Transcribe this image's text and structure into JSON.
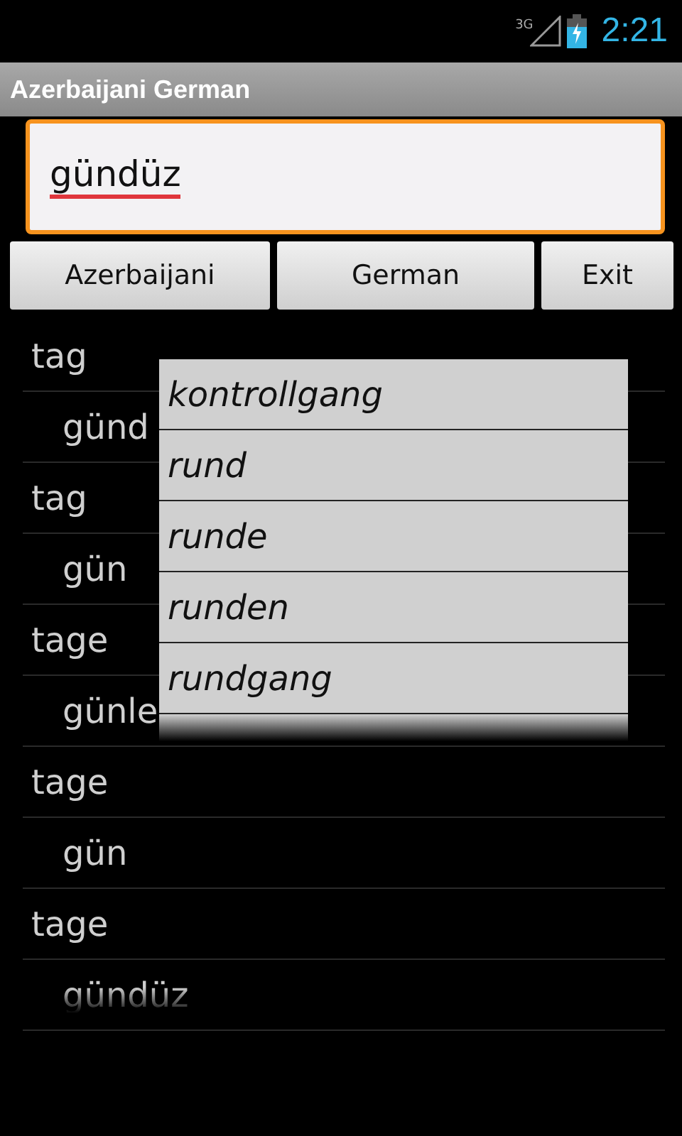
{
  "status_bar": {
    "network": "3G",
    "time": "2:21"
  },
  "window": {
    "title": "Azerbaijani German"
  },
  "search": {
    "value": "gündüz"
  },
  "buttons": [
    "Azerbaijani",
    "German",
    "Exit"
  ],
  "results": [
    {
      "kind": "term",
      "text": "tag"
    },
    {
      "kind": "translation",
      "text": "günd"
    },
    {
      "kind": "term",
      "text": "tag"
    },
    {
      "kind": "translation",
      "text": "gün"
    },
    {
      "kind": "term",
      "text": "tage"
    },
    {
      "kind": "translation",
      "text": "günle"
    },
    {
      "kind": "term",
      "text": "tage"
    },
    {
      "kind": "translation",
      "text": "gün"
    },
    {
      "kind": "term",
      "text": "tage"
    },
    {
      "kind": "translation",
      "text": "gündüz"
    }
  ],
  "suggestions": [
    "kontrollgang",
    "rund",
    "runde",
    "runden",
    "rundgang"
  ]
}
